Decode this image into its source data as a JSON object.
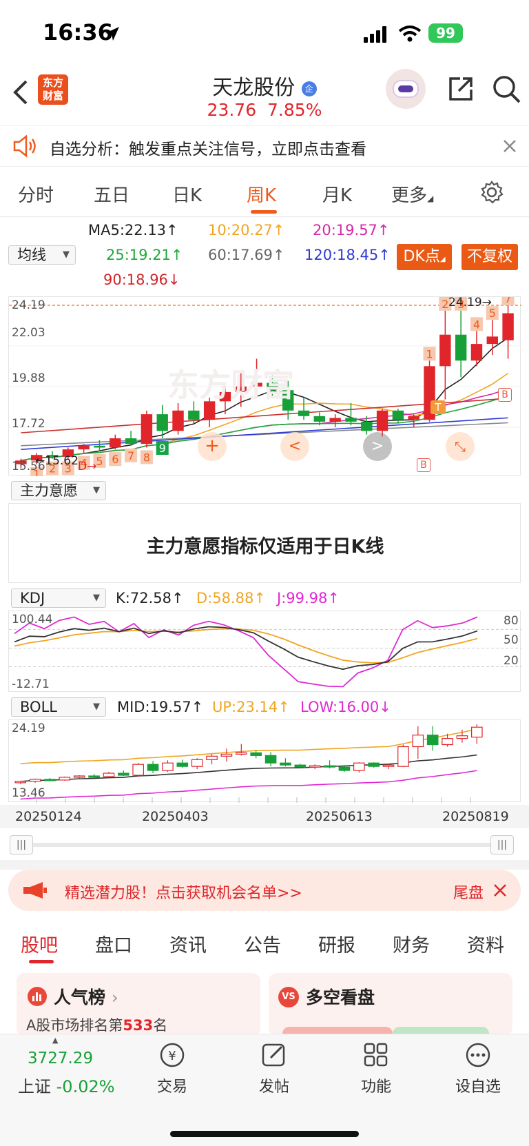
{
  "status": {
    "time": "16:36",
    "battery": "99"
  },
  "header": {
    "stock_name": "天龙股份",
    "stock_badge": "企",
    "price": "23.76",
    "change_pct": "7.85%",
    "logo_line1": "东方",
    "logo_line2": "财富"
  },
  "notice": {
    "text": "自选分析：触发重点关注信号，立即点击查看"
  },
  "tabs": [
    {
      "label": "分时"
    },
    {
      "label": "五日"
    },
    {
      "label": "日K"
    },
    {
      "label": "周K"
    },
    {
      "label": "月K"
    },
    {
      "label": "更多"
    }
  ],
  "active_tab": "周K",
  "ma_panel": {
    "selector": "均线",
    "ma5": "MA5:22.13↑",
    "ma10": "10:20.27↑",
    "ma20": "20:19.57↑",
    "ma25": "25:19.21↑",
    "ma60": "60:17.69↑",
    "ma120": "120:18.45↑",
    "ma90": "90:18.96↓",
    "dk_button": "DK点",
    "fq_button": "不复权"
  },
  "kline": {
    "y_labels": [
      "24.19",
      "22.03",
      "19.88",
      "17.72",
      "15.56"
    ],
    "high_label": "24.19",
    "low_label": "15.62",
    "watermark": "东方财富",
    "d_marker": "D",
    "markers": [
      "1",
      "2",
      "3",
      "4",
      "5",
      "6",
      "7",
      "8",
      "9",
      "1",
      "2",
      "3",
      "4",
      "5",
      "6",
      "7"
    ],
    "signal_b": "B",
    "signal_t": "T"
  },
  "zlyy": {
    "selector": "主力意愿",
    "message": "主力意愿指标仅适用于日K线"
  },
  "kdj": {
    "selector": "KDJ",
    "k": "K:72.58↑",
    "d": "D:58.88↑",
    "j": "J:99.98↑",
    "top": "100.44",
    "bottom": "-12.71",
    "levels": [
      "80",
      "50",
      "20"
    ]
  },
  "boll": {
    "selector": "BOLL",
    "mid": "MID:19.57↑",
    "up": "UP:23.14↑",
    "low": "LOW:16.00↓",
    "top": "24.19",
    "bottom": "13.46"
  },
  "dates": [
    "20250124",
    "20250403",
    "20250613",
    "20250819"
  ],
  "promo": {
    "text": "精选潜力股！点击获取机会名单>>",
    "right": "尾盘"
  },
  "bottom_tabs": [
    {
      "label": "股吧"
    },
    {
      "label": "盘口"
    },
    {
      "label": "资讯"
    },
    {
      "label": "公告"
    },
    {
      "label": "研报"
    },
    {
      "label": "财务"
    },
    {
      "label": "资料"
    }
  ],
  "cards": {
    "popularity_title": "人气榜",
    "popularity_desc_pre": "A股市场排名第",
    "popularity_rank": "533",
    "popularity_desc_post": "名",
    "longshort_title": "多空看盘"
  },
  "dock": {
    "index_value": "3727.29",
    "index_name": "上证",
    "index_change": "-0.02%",
    "items": [
      {
        "label": "交易"
      },
      {
        "label": "发帖"
      },
      {
        "label": "功能"
      },
      {
        "label": "设自选"
      }
    ]
  },
  "colors": {
    "up": "#e0262b",
    "down": "#18a038",
    "accent": "#ef5b1c"
  },
  "chart_data": {
    "type": "candlestick",
    "candles": [
      {
        "o": 15.6,
        "h": 15.9,
        "l": 15.4,
        "c": 15.8
      },
      {
        "o": 15.8,
        "h": 16.2,
        "l": 15.6,
        "c": 16.1
      },
      {
        "o": 16.1,
        "h": 16.3,
        "l": 15.9,
        "c": 16.0
      },
      {
        "o": 16.0,
        "h": 16.5,
        "l": 15.9,
        "c": 16.4
      },
      {
        "o": 16.4,
        "h": 16.7,
        "l": 16.2,
        "c": 16.6
      },
      {
        "o": 16.6,
        "h": 16.9,
        "l": 16.3,
        "c": 16.5
      },
      {
        "o": 16.5,
        "h": 17.2,
        "l": 16.4,
        "c": 17.0
      },
      {
        "o": 17.0,
        "h": 17.4,
        "l": 16.6,
        "c": 16.7
      },
      {
        "o": 16.7,
        "h": 18.5,
        "l": 16.5,
        "c": 18.3
      },
      {
        "o": 18.3,
        "h": 18.8,
        "l": 17.0,
        "c": 17.4
      },
      {
        "o": 17.4,
        "h": 18.9,
        "l": 17.2,
        "c": 18.5
      },
      {
        "o": 18.5,
        "h": 19.0,
        "l": 17.8,
        "c": 18.0
      },
      {
        "o": 18.0,
        "h": 19.2,
        "l": 17.6,
        "c": 19.0
      },
      {
        "o": 19.0,
        "h": 19.8,
        "l": 18.3,
        "c": 19.5
      },
      {
        "o": 19.5,
        "h": 20.6,
        "l": 18.7,
        "c": 19.8
      },
      {
        "o": 19.8,
        "h": 21.3,
        "l": 19.6,
        "c": 20.0
      },
      {
        "o": 20.0,
        "h": 20.4,
        "l": 19.2,
        "c": 19.6
      },
      {
        "o": 19.6,
        "h": 20.1,
        "l": 18.0,
        "c": 18.5
      },
      {
        "o": 18.5,
        "h": 19.2,
        "l": 18.0,
        "c": 18.2
      },
      {
        "o": 18.2,
        "h": 18.4,
        "l": 17.7,
        "c": 17.9
      },
      {
        "o": 17.9,
        "h": 18.3,
        "l": 17.6,
        "c": 18.1
      },
      {
        "o": 18.1,
        "h": 18.9,
        "l": 17.7,
        "c": 17.9
      },
      {
        "o": 17.9,
        "h": 18.2,
        "l": 17.2,
        "c": 17.4
      },
      {
        "o": 17.4,
        "h": 18.6,
        "l": 17.1,
        "c": 18.5
      },
      {
        "o": 18.5,
        "h": 18.6,
        "l": 17.8,
        "c": 18.0
      },
      {
        "o": 18.0,
        "h": 18.3,
        "l": 17.6,
        "c": 18.2
      },
      {
        "o": 18.0,
        "h": 21.2,
        "l": 17.9,
        "c": 20.9
      },
      {
        "o": 20.9,
        "h": 23.9,
        "l": 19.1,
        "c": 22.6
      },
      {
        "o": 22.6,
        "h": 23.9,
        "l": 20.3,
        "c": 21.2
      },
      {
        "o": 21.2,
        "h": 22.8,
        "l": 20.9,
        "c": 22.1
      },
      {
        "o": 22.1,
        "h": 23.4,
        "l": 21.5,
        "c": 22.5
      },
      {
        "o": 22.3,
        "h": 24.19,
        "l": 21.3,
        "c": 23.76
      }
    ],
    "ylim": [
      15.4,
      24.19
    ]
  }
}
